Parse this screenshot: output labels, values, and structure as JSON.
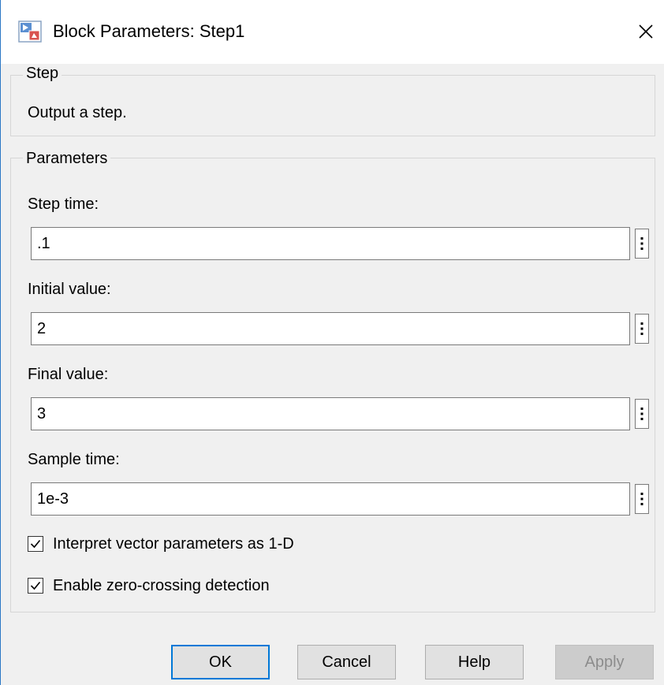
{
  "window": {
    "title": "Block Parameters: Step1",
    "close_icon": "close-icon",
    "app_icon": "simulink-block-icon"
  },
  "step_group": {
    "legend": "Step",
    "description": "Output a step."
  },
  "params_group": {
    "legend": "Parameters",
    "fields": [
      {
        "label": "Step time:",
        "value": ".1"
      },
      {
        "label": "Initial value:",
        "value": "2"
      },
      {
        "label": "Final value:",
        "value": "3"
      },
      {
        "label": "Sample time:",
        "value": "1e-3"
      }
    ],
    "checkboxes": [
      {
        "label": "Interpret vector parameters as 1-D",
        "checked": true
      },
      {
        "label": "Enable zero-crossing detection",
        "checked": true
      }
    ]
  },
  "buttons": {
    "ok": "OK",
    "cancel": "Cancel",
    "help": "Help",
    "apply": "Apply"
  },
  "colors": {
    "accent": "#0078d7",
    "window_bg": "#f0f0f0",
    "border": "#d6d6d6"
  }
}
